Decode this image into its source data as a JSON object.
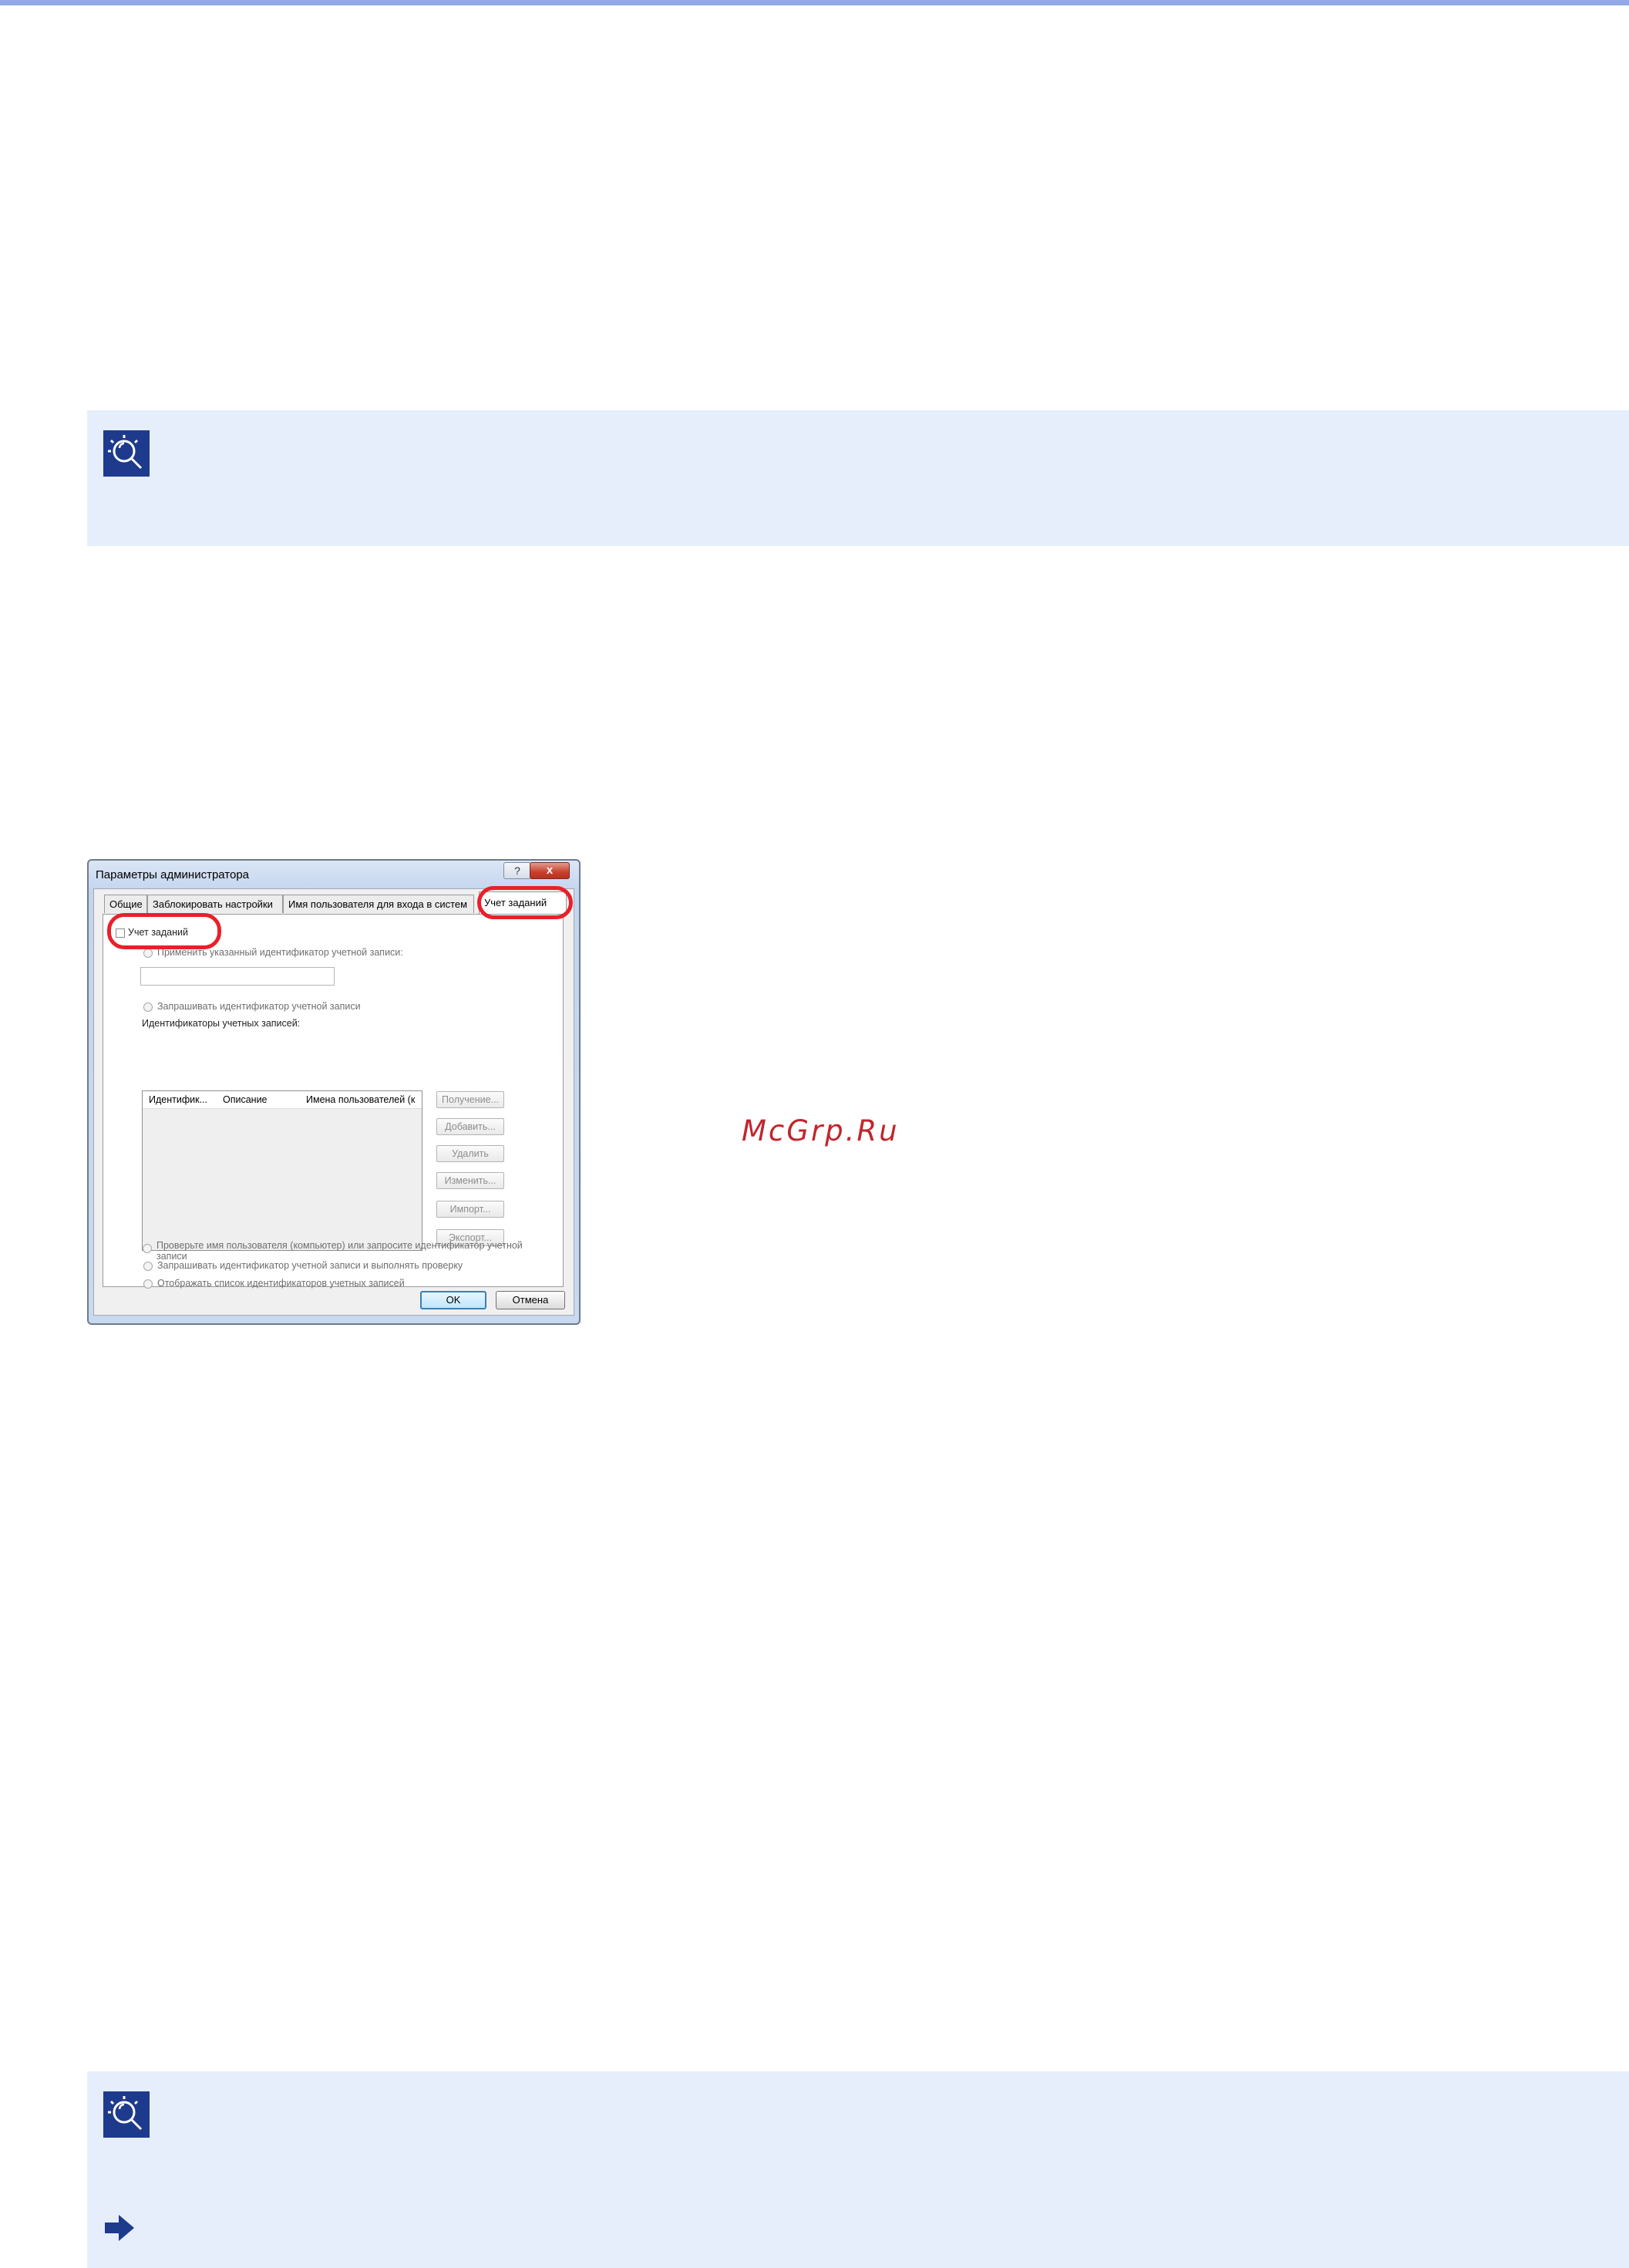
{
  "dialog": {
    "title": "Параметры администратора",
    "help": "?",
    "close": "x",
    "tabs": [
      "Общие",
      "Заблокировать настройки",
      "Имя пользователя для входа в систем",
      "Учет заданий"
    ],
    "job_accounting_checkbox": "Учет заданий",
    "option_use_specified": "Применить указанный идентификатор учетной записи:",
    "option_prompt": "Запрашивать идентификатор учетной записи",
    "accounts_label": "Идентификаторы учетных записей:",
    "columns": [
      "Идентифик...",
      "Описание",
      "Имена пользователей (к"
    ],
    "side_buttons": [
      "Получение...",
      "Добавить...",
      "Удалить",
      "Изменить...",
      "Импорт...",
      "Экспорт..."
    ],
    "option_prompt_validate": "Запрашивать идентификатор учетной записи и выполнять проверку",
    "option_display_list": "Отображать список идентификаторов учетных записей",
    "option_verify_user_1": "Проверьте имя пользователя (компьютер) или запросите идентификатор учетной",
    "option_verify_user_2": "записи",
    "ok": "OK",
    "cancel": "Отмена"
  },
  "watermark": "McGrp.Ru",
  "colors": {
    "note_background": "#e6edfb",
    "top_rule": "#93a8e6",
    "icon_blue": "#1d3a8c",
    "highlight_red": "#e8202a",
    "watermark_red": "#c0262d"
  },
  "icons": {
    "note_1": "lightbulb-note-icon",
    "note_2": "lightbulb-note-icon",
    "arrow": "arrow-right-icon"
  }
}
